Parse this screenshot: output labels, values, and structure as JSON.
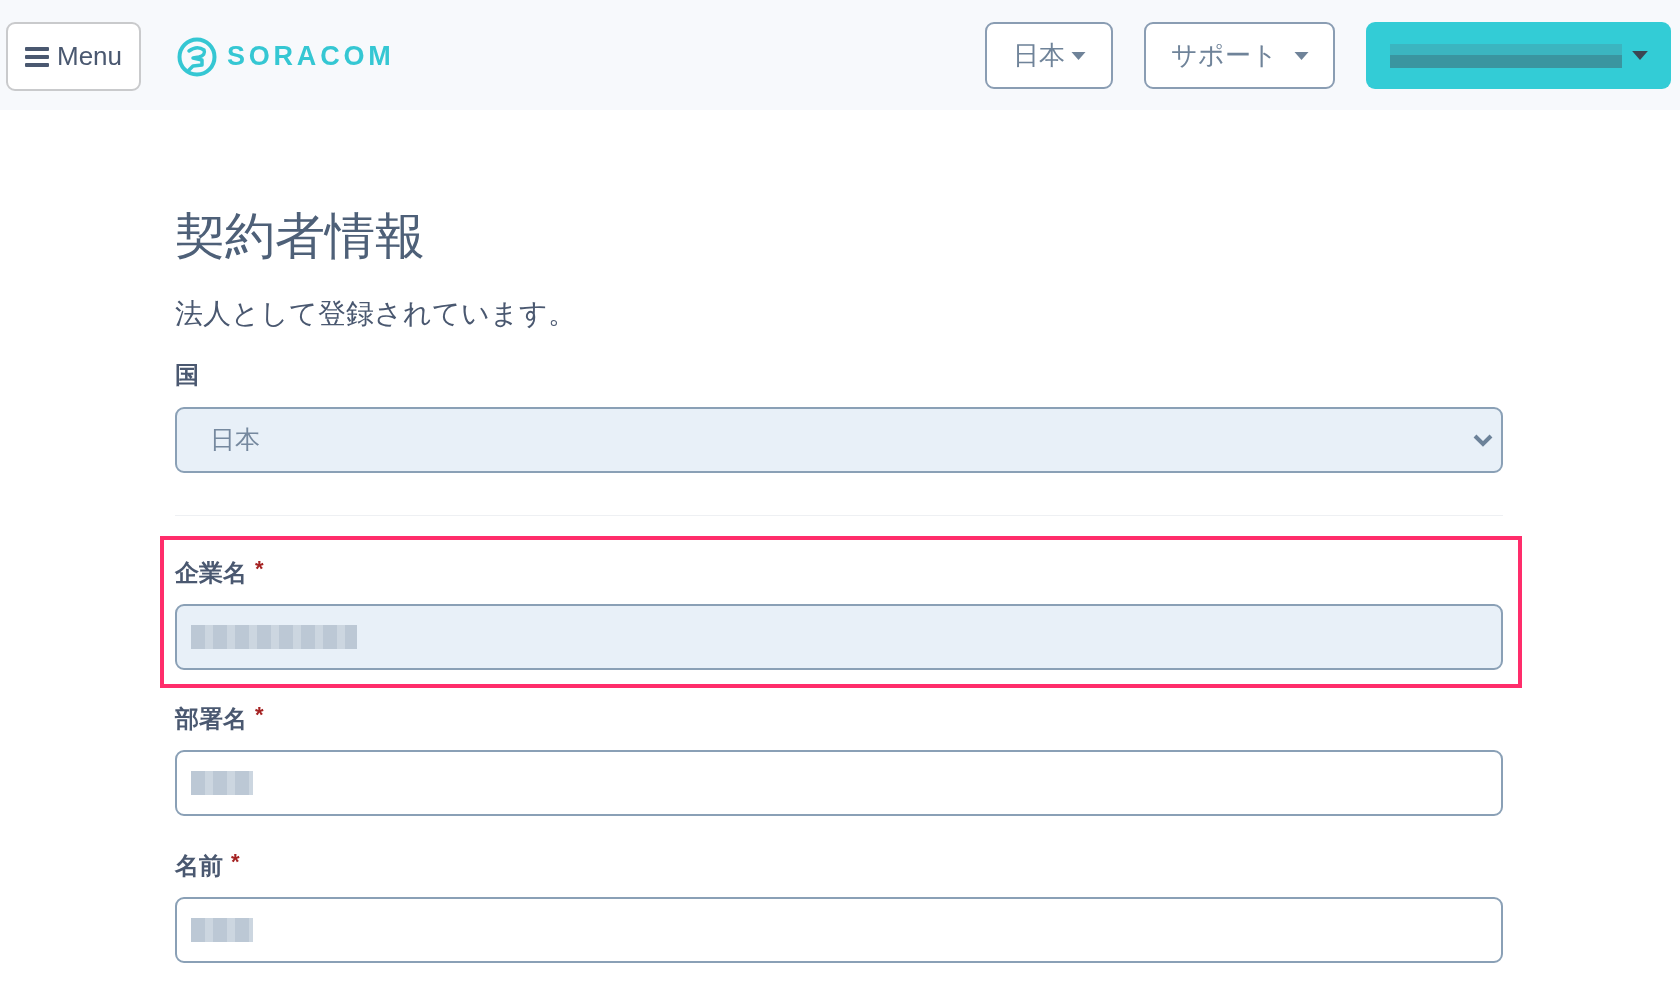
{
  "header": {
    "menu_button": {
      "label": "Menu"
    },
    "logo": {
      "text": "SORACOM"
    },
    "language_menu": {
      "label": "日本"
    },
    "support_menu": {
      "label": "サポート"
    },
    "account_menu": {
      "label_blurred": true
    }
  },
  "page": {
    "title": "契約者情報",
    "description": "法人として登録されています。",
    "country": {
      "label": "国",
      "value": "日本"
    },
    "fields": [
      {
        "label": "企業名",
        "required_mark": "*",
        "value_blurred": true,
        "autofilled": true,
        "highlighted": true
      },
      {
        "label": "部署名",
        "required_mark": "*",
        "value_blurred": true,
        "autofilled": false,
        "highlighted": false
      },
      {
        "label": "名前",
        "required_mark": "*",
        "value_blurred": true,
        "autofilled": false,
        "highlighted": false
      }
    ]
  }
}
